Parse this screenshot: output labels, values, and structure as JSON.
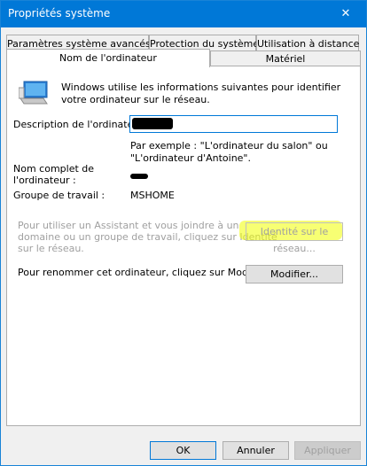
{
  "window": {
    "title": "Propriétés système",
    "close_glyph": "✕"
  },
  "tabs": {
    "row_back": [
      "Paramètres système avancés",
      "Protection du système",
      "Utilisation à distance"
    ],
    "row_front": [
      "Nom de l'ordinateur",
      "Matériel"
    ],
    "active": "Nom de l'ordinateur"
  },
  "content": {
    "intro": "Windows utilise les informations suivantes pour identifier votre ordinateur sur le réseau.",
    "description_label": "Description de l'ordinateur :",
    "description_value": "",
    "example_line1": "Par exemple : \"L'ordinateur du salon\" ou",
    "example_line2": "\"L'ordinateur d'Antoine\".",
    "fullname_label_line1": "Nom complet de",
    "fullname_label_line2": "l'ordinateur :",
    "workgroup_label": "Groupe de travail :",
    "workgroup_value": "MSHOME",
    "assistant_line1": "Pour utiliser un Assistant et vous joindre à un",
    "assistant_line2": "domaine ou un groupe de travail, cliquez sur Identité",
    "assistant_line3": "sur le réseau.",
    "network_id_button": "Identité sur le réseau...",
    "rename_text": "Pour renommer cet ordinateur, cliquez sur Modifier.",
    "modify_button": "Modifier..."
  },
  "footer": {
    "ok": "OK",
    "cancel": "Annuler",
    "apply": "Appliquer"
  },
  "icons": {
    "computer": "computer-icon",
    "close": "close-icon"
  },
  "colors": {
    "accent": "#0078d7",
    "highlight": "#f0ff00"
  }
}
